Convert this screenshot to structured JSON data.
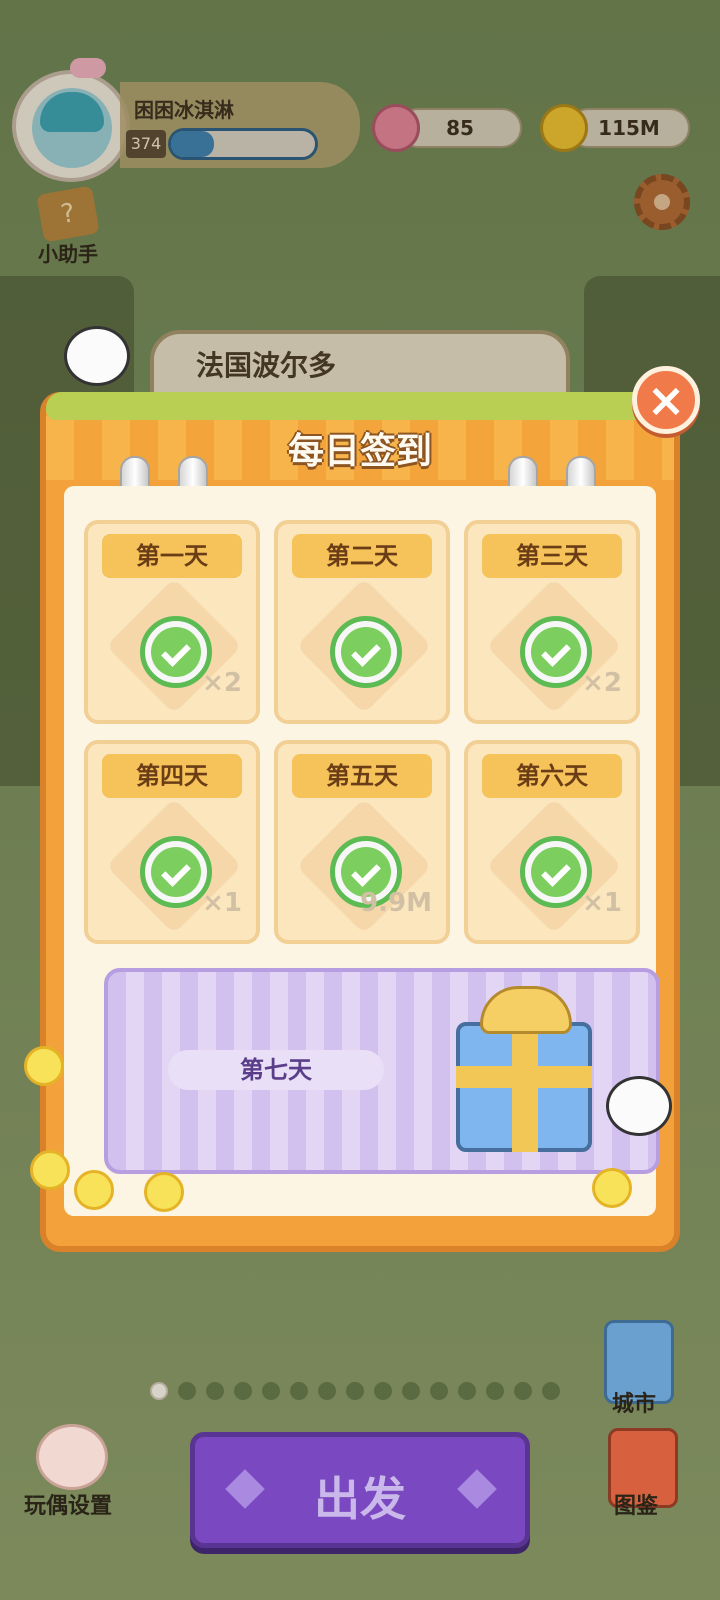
{
  "player": {
    "name": "困困冰淇淋",
    "level": "374",
    "xp_fraction": 0.3
  },
  "currency": {
    "gems": "85",
    "coins": "115M"
  },
  "helper": {
    "label": "小助手"
  },
  "location": {
    "name": "法国波尔多"
  },
  "checkin": {
    "title": "每日签到",
    "days": [
      {
        "label": "第一天",
        "qty": "×2",
        "claimed": true
      },
      {
        "label": "第二天",
        "qty": "",
        "claimed": true
      },
      {
        "label": "第三天",
        "qty": "×2",
        "claimed": true
      },
      {
        "label": "第四天",
        "qty": "×1",
        "claimed": true
      },
      {
        "label": "第五天",
        "qty": "9.9M",
        "claimed": true
      },
      {
        "label": "第六天",
        "qty": "×1",
        "claimed": true
      }
    ],
    "day7": {
      "label": "第七天"
    }
  },
  "bottom": {
    "city_label": "城市",
    "book_label": "图鉴",
    "doll_label": "玩偶设置",
    "go_label": "出发",
    "page_count": 15,
    "active_page": 0
  },
  "colors": {
    "accent": "#f3a23b",
    "go_button": "#7a48c0",
    "check": "#7cce5e"
  }
}
